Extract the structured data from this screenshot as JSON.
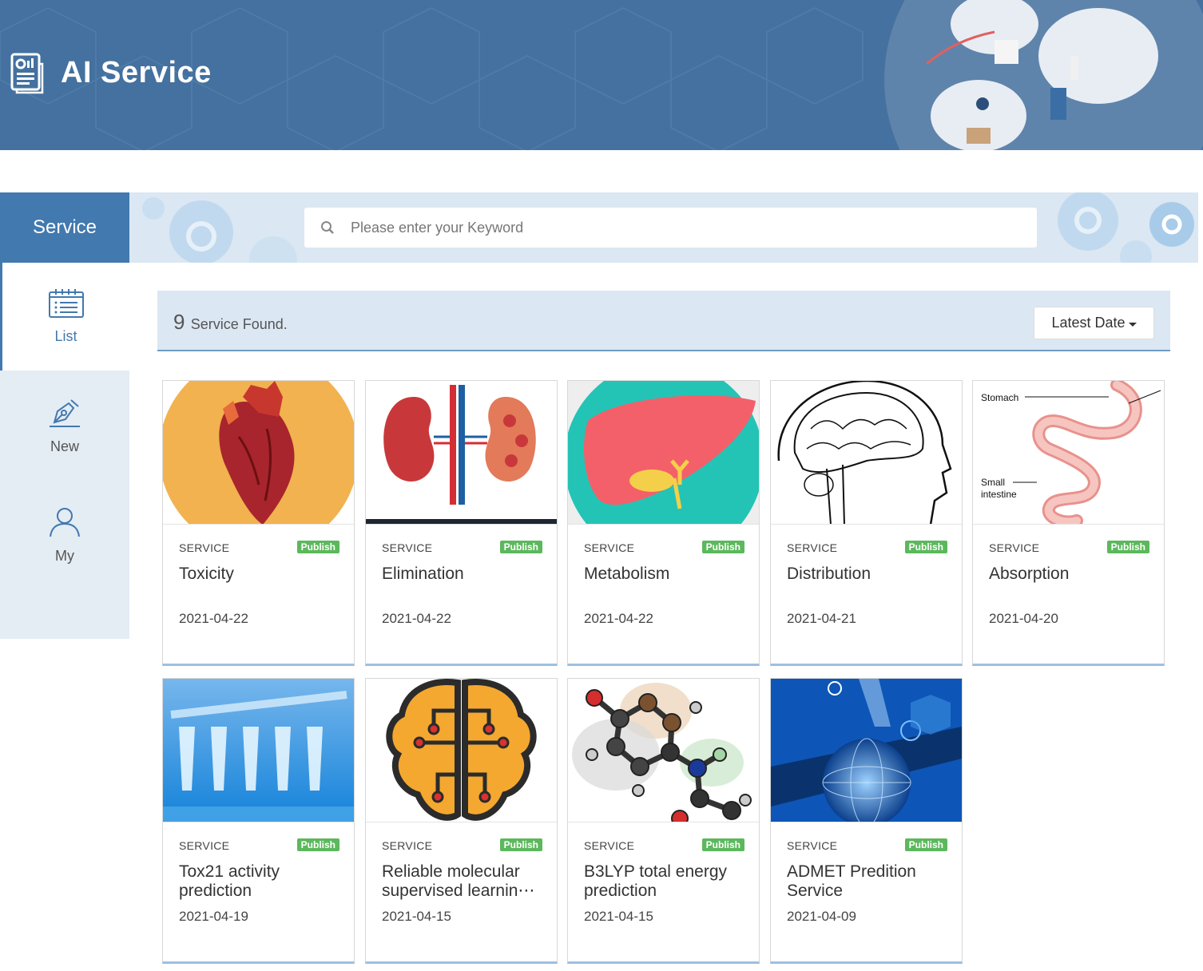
{
  "header": {
    "title": "AI Service",
    "icon": "report-chart-icon"
  },
  "sidebar": {
    "heading": "Service",
    "items": [
      {
        "label": "List",
        "icon": "list-calendar-icon",
        "active": true
      },
      {
        "label": "New",
        "icon": "pen-nib-icon",
        "active": false
      },
      {
        "label": "My",
        "icon": "user-icon",
        "active": false
      }
    ]
  },
  "search": {
    "placeholder": "Please enter your Keyword",
    "value": ""
  },
  "results": {
    "count": "9",
    "label": "Service Found.",
    "sort_label": "Latest Date"
  },
  "colors": {
    "banner": "#44719f",
    "accent": "#4279af",
    "publish": "#5cb85c",
    "panel": "#dbe7f2"
  },
  "cards": [
    {
      "type": "SERVICE",
      "badge": "Publish",
      "title": "Toxicity",
      "date": "2021-04-22",
      "image": "heart-illustration"
    },
    {
      "type": "SERVICE",
      "badge": "Publish",
      "title": "Elimination",
      "date": "2021-04-22",
      "image": "kidney-illustration"
    },
    {
      "type": "SERVICE",
      "badge": "Publish",
      "title": "Metabolism",
      "date": "2021-04-22",
      "image": "liver-illustration"
    },
    {
      "type": "SERVICE",
      "badge": "Publish",
      "title": "Distribution",
      "date": "2021-04-21",
      "image": "brain-sketch"
    },
    {
      "type": "SERVICE",
      "badge": "Publish",
      "title": "Absorption",
      "date": "2021-04-20",
      "image": "stomach-diagram",
      "image_labels": [
        "Stomach",
        "Small",
        "intestine"
      ]
    },
    {
      "type": "SERVICE",
      "badge": "Publish",
      "title": "Tox21 activity prediction",
      "date": "2021-04-19",
      "image": "test-tubes-photo"
    },
    {
      "type": "SERVICE",
      "badge": "Publish",
      "title": "Reliable molecular supervised learnin⋯",
      "date": "2021-04-15",
      "image": "circuit-brain-icon"
    },
    {
      "type": "SERVICE",
      "badge": "Publish",
      "title": "B3LYP total energy prediction",
      "date": "2021-04-15",
      "image": "molecule-model"
    },
    {
      "type": "SERVICE",
      "badge": "Publish",
      "title": "ADMET Predition Service",
      "date": "2021-04-09",
      "image": "globe-tech-photo"
    }
  ]
}
